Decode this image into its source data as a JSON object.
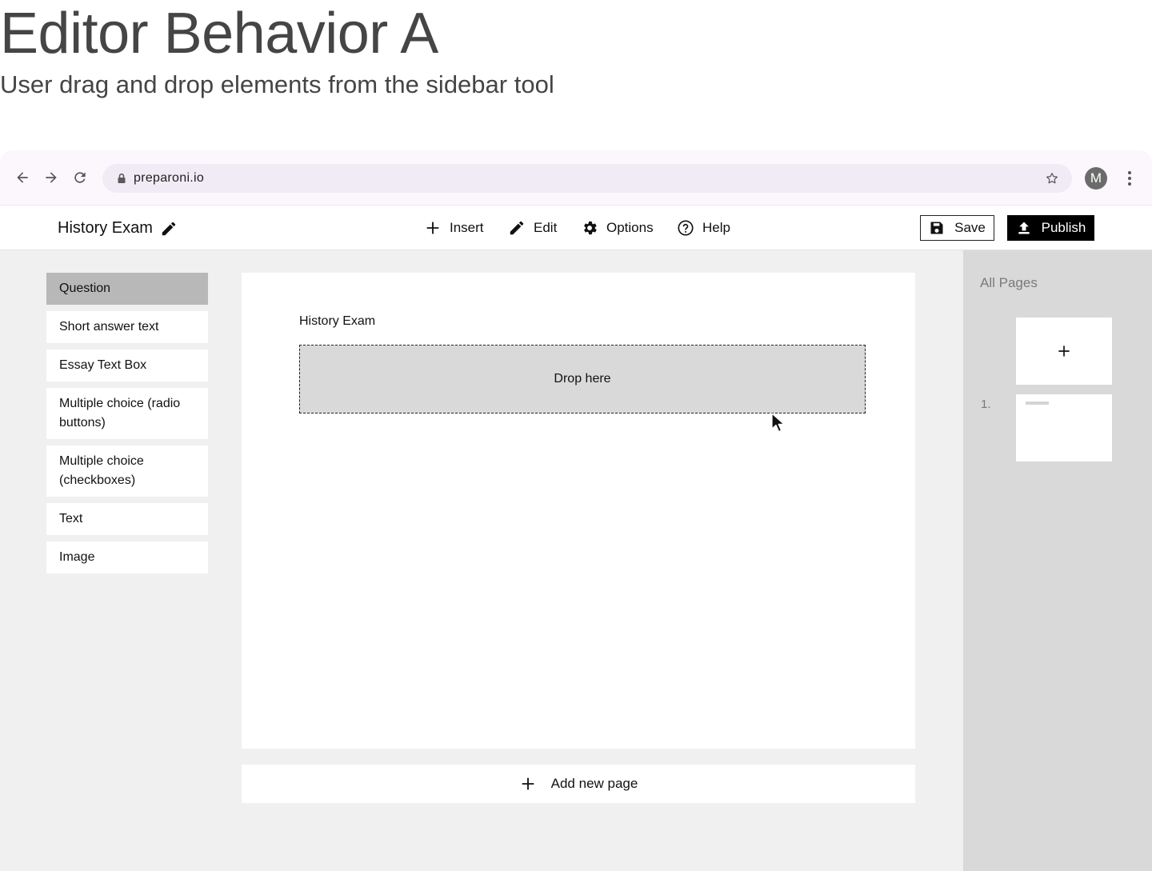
{
  "hero": {
    "title": "Editor Behavior A",
    "subtitle": "User drag and drop elements from the sidebar tool"
  },
  "browser": {
    "url": "preparoni.io",
    "avatar_initial": "M",
    "icons": [
      "back-arrow-icon",
      "forward-arrow-icon",
      "reload-icon",
      "lock-icon",
      "star-icon",
      "kebab-menu-icon"
    ]
  },
  "header": {
    "doc_title": "History Exam",
    "menu": {
      "insert": "Insert",
      "edit": "Edit",
      "options": "Options",
      "help": "Help"
    },
    "save_label": "Save",
    "publish_label": "Publish"
  },
  "sidebar": {
    "items": [
      {
        "label": "Question",
        "active": true
      },
      {
        "label": "Short answer text",
        "active": false
      },
      {
        "label": "Essay Text Box",
        "active": false
      },
      {
        "label": "Multiple choice (radio buttons)",
        "active": false
      },
      {
        "label": "Multiple choice (checkboxes)",
        "active": false
      },
      {
        "label": "Text",
        "active": false
      },
      {
        "label": "Image",
        "active": false
      }
    ]
  },
  "canvas": {
    "title": "History Exam",
    "drop_zone_label": "Drop here"
  },
  "add_page_label": "Add new page",
  "pages_panel": {
    "title": "All Pages",
    "pages": [
      {
        "number": "1."
      }
    ]
  },
  "colors": {
    "chrome_bg": "#fcf7fd",
    "address_bg": "#f1ebf6",
    "workspace_bg": "#f0f0f0",
    "active_tool": "#b8b8b8",
    "drop_zone": "#d9d9d9",
    "publish_bg": "#000000"
  }
}
